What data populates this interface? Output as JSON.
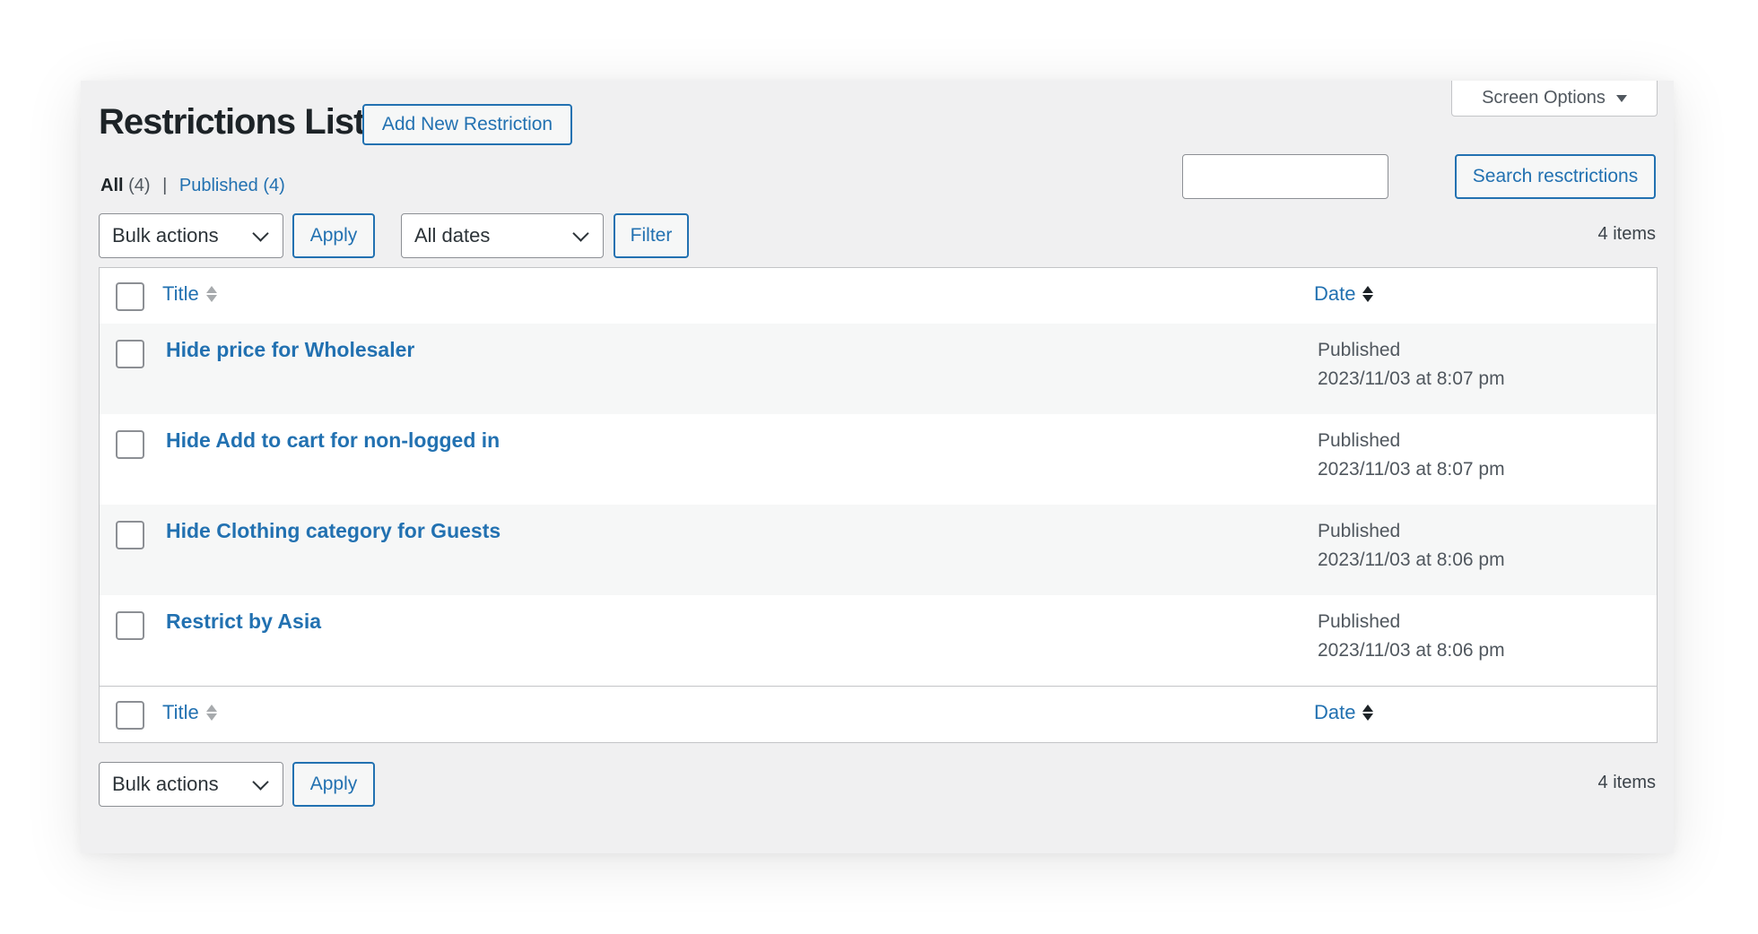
{
  "header": {
    "title": "Restrictions List",
    "add_new_label": "Add New Restriction",
    "screen_options_label": "Screen Options"
  },
  "views": [
    {
      "label": "All",
      "count": "(4)"
    },
    {
      "label": "Published",
      "count": "(4)"
    }
  ],
  "search": {
    "value": "",
    "button_label": "Search resctrictions"
  },
  "toolbar_top": {
    "bulk_actions": "Bulk actions",
    "apply_label": "Apply",
    "dates_filter": "All dates",
    "filter_label": "Filter",
    "item_count": "4 items"
  },
  "table": {
    "columns": {
      "title": "Title",
      "date": "Date"
    },
    "rows": [
      {
        "title": "Hide price for Wholesaler",
        "status": "Published",
        "date": "2023/11/03 at 8:07 pm"
      },
      {
        "title": "Hide Add to cart for non-logged in",
        "status": "Published",
        "date": "2023/11/03 at 8:07 pm"
      },
      {
        "title": "Hide Clothing category for Guests",
        "status": "Published",
        "date": "2023/11/03 at 8:06 pm"
      },
      {
        "title": "Restrict by Asia",
        "status": "Published",
        "date": "2023/11/03 at 8:06 pm"
      }
    ]
  },
  "toolbar_bottom": {
    "bulk_actions": "Bulk actions",
    "apply_label": "Apply",
    "item_count": "4 items"
  },
  "colors": {
    "accent": "#2271b1",
    "background": "#f0f0f1",
    "row_alt": "#f6f7f7"
  }
}
